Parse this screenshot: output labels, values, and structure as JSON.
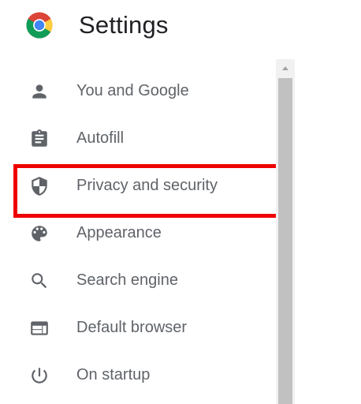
{
  "app": {
    "title": "Settings",
    "logo_icon": "chrome-logo-icon"
  },
  "sidebar": {
    "items": [
      {
        "label": "You and Google",
        "icon": "person-icon"
      },
      {
        "label": "Autofill",
        "icon": "clipboard-icon"
      },
      {
        "label": "Privacy and security",
        "icon": "shield-icon",
        "highlighted": true
      },
      {
        "label": "Appearance",
        "icon": "palette-icon"
      },
      {
        "label": "Search engine",
        "icon": "search-icon"
      },
      {
        "label": "Default browser",
        "icon": "browser-window-icon"
      },
      {
        "label": "On startup",
        "icon": "power-icon"
      }
    ]
  },
  "colors": {
    "text_primary": "#202124",
    "text_secondary": "#5f6368",
    "highlight_border": "#ef0000",
    "scrollbar_track": "#f1f1f1",
    "scrollbar_thumb": "#c1c1c1"
  }
}
